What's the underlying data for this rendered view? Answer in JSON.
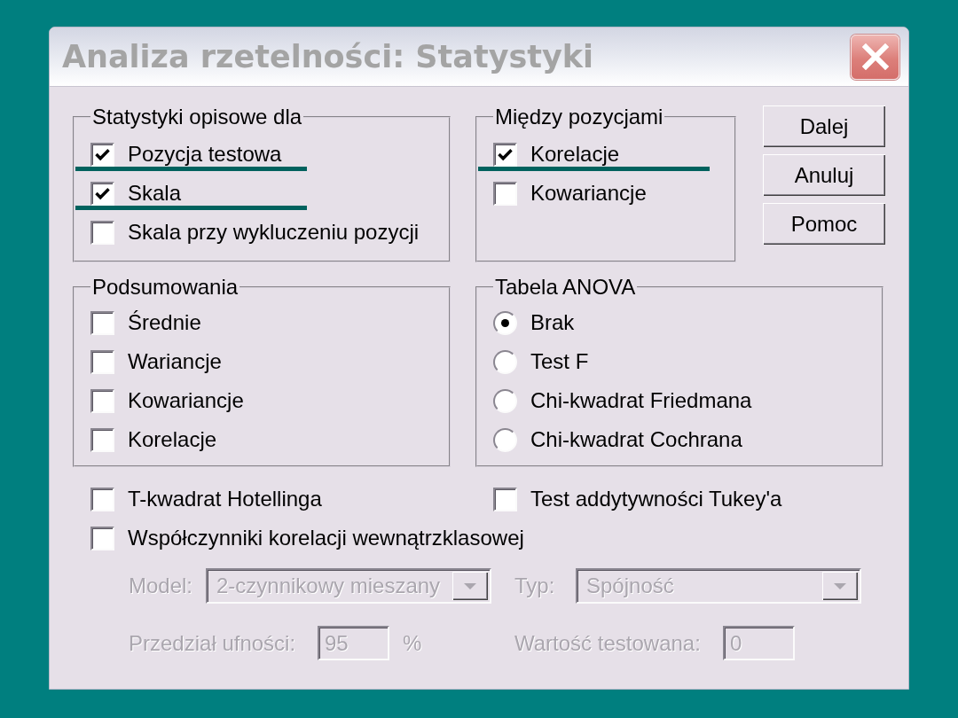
{
  "window": {
    "title": "Analiza rzetelności: Statystyki",
    "active": false
  },
  "descriptives": {
    "title": "Statystyki opisowe dla",
    "items": [
      {
        "label": "Pozycja testowa",
        "checked": true,
        "underlined": true
      },
      {
        "label": "Skala",
        "checked": true,
        "underlined": true
      },
      {
        "label": "Skala przy wykluczeniu pozycji",
        "checked": false,
        "underlined": false
      }
    ]
  },
  "inter_item": {
    "title": "Między pozycjami",
    "items": [
      {
        "label": "Korelacje",
        "checked": true,
        "underlined": true
      },
      {
        "label": "Kowariancje",
        "checked": false,
        "underlined": false
      }
    ]
  },
  "buttons": [
    "Dalej",
    "Anuluj",
    "Pomoc"
  ],
  "summaries": {
    "title": "Podsumowania",
    "items": [
      {
        "label": "Średnie",
        "checked": false
      },
      {
        "label": "Wariancje",
        "checked": false
      },
      {
        "label": "Kowariancje",
        "checked": false
      },
      {
        "label": "Korelacje",
        "checked": false
      }
    ]
  },
  "anova_table": {
    "title": "Tabela ANOVA",
    "options": [
      {
        "label": "Brak",
        "selected": true
      },
      {
        "label": "Test F",
        "selected": false
      },
      {
        "label": "Chi-kwadrat Friedmana",
        "selected": false
      },
      {
        "label": "Chi-kwadrat Cochrana",
        "selected": false
      }
    ]
  },
  "extra_options": [
    {
      "label": "T-kwadrat Hotellinga",
      "checked": false
    },
    {
      "label": "Test addytywności Tukey'a",
      "checked": false
    }
  ],
  "intraclass": {
    "label": "Współczynniki korelacji wewnątrzklasowej",
    "checked": false
  },
  "intraclass_settings": {
    "model": {
      "label": "Model:",
      "value": "2-czynnikowy mieszany",
      "disabled": true
    },
    "type": {
      "label": "Typ:",
      "value": "Spójność",
      "disabled": true
    },
    "confidence": {
      "label": "Przedział ufności:",
      "value": "95",
      "unit": "%",
      "disabled": true
    },
    "test_value": {
      "label": "Wartość testowana:",
      "value": "0",
      "disabled": true
    }
  }
}
